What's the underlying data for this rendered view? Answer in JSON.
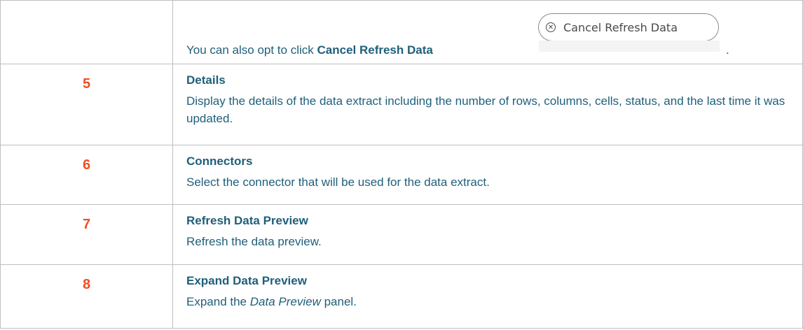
{
  "rows": [
    {
      "number": "",
      "text_prefix": "You can also opt to click ",
      "text_bold": "Cancel Refresh Data",
      "text_suffix": ".",
      "button": {
        "icon": "cancel-circle-icon",
        "label": "Cancel Refresh Data"
      }
    },
    {
      "number": "5",
      "title": "Details",
      "text": "Display the details of the data extract including the number of rows, columns, cells, status, and the last time it was updated."
    },
    {
      "number": "6",
      "title": "Connectors",
      "text": "Select the connector that will be used for the data extract."
    },
    {
      "number": "7",
      "title": "Refresh Data Preview",
      "text": "Refresh the data preview."
    },
    {
      "number": "8",
      "title": "Expand Data Preview",
      "text_prefix": "Expand the ",
      "text_italic": "Data Preview",
      "text_suffix": " panel."
    }
  ],
  "colors": {
    "number": "#f04e23",
    "text": "#1f5f7a",
    "border": "#bfbfbf"
  }
}
